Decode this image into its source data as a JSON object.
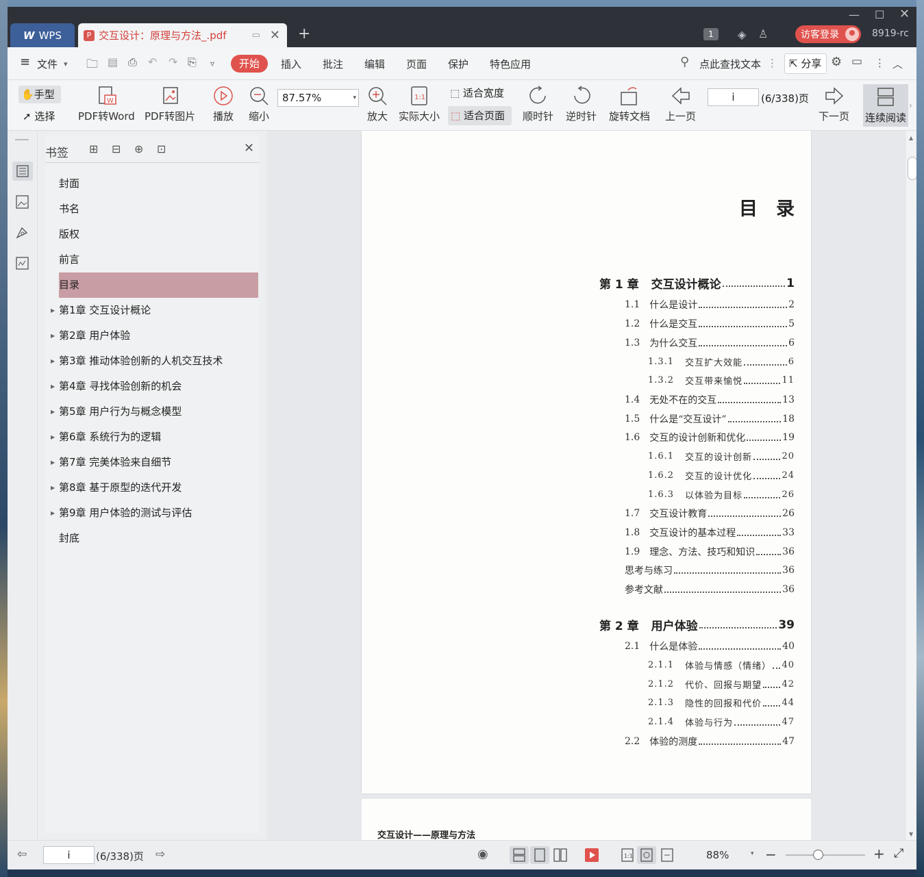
{
  "app": {
    "wps_tab": "WPS",
    "doc_tab": "交互设计：原理与方法_.pdf",
    "badge": "1",
    "login": "访客登录",
    "user": "8919-rc"
  },
  "menu": {
    "file": "文件",
    "start": "开始",
    "insert": "插入",
    "comment": "批注",
    "edit": "编辑",
    "page": "页面",
    "protect": "保护",
    "special": "特色应用",
    "search": "点此查找文本",
    "share": "分享"
  },
  "ribbon": {
    "hand": "手型",
    "select": "选择",
    "pdf2word": "PDF转Word",
    "pdf2img": "PDF转图片",
    "play": "播放",
    "zoom_out": "缩小",
    "zoom_value": "87.57%",
    "zoom_in": "放大",
    "actual": "实际大小",
    "fit_width": "适合宽度",
    "fit_page": "适合页面",
    "clockwise": "顺时针",
    "counter": "逆时针",
    "rotate": "旋转文档",
    "prev": "上一页",
    "page_input": "i",
    "page_total": "(6/338)页",
    "next": "下一页",
    "continuous": "连续阅读"
  },
  "panel": {
    "title": "书签",
    "items": [
      {
        "label": "封面",
        "expand": false
      },
      {
        "label": "书名",
        "expand": false
      },
      {
        "label": "版权",
        "expand": false
      },
      {
        "label": "前言",
        "expand": false
      },
      {
        "label": "目录",
        "expand": false,
        "selected": true
      },
      {
        "label": "第1章 交互设计概论",
        "expand": true
      },
      {
        "label": "第2章 用户体验",
        "expand": true
      },
      {
        "label": "第3章 推动体验创新的人机交互技术",
        "expand": true
      },
      {
        "label": "第4章 寻找体验创新的机会",
        "expand": true
      },
      {
        "label": "第5章 用户行为与概念模型",
        "expand": true
      },
      {
        "label": "第6章 系统行为的逻辑",
        "expand": true
      },
      {
        "label": "第7章 完美体验来自细节",
        "expand": true
      },
      {
        "label": "第8章 基于原型的迭代开发",
        "expand": true
      },
      {
        "label": "第9章 用户体验的测试与评估",
        "expand": true
      },
      {
        "label": "封底",
        "expand": false
      }
    ]
  },
  "page": {
    "title": "目　录",
    "toc": [
      {
        "level": "ch",
        "num": "第 1 章",
        "text": "交互设计概论",
        "page": "1"
      },
      {
        "level": "sec",
        "num": "1.1",
        "text": "什么是设计",
        "page": "2"
      },
      {
        "level": "sec",
        "num": "1.2",
        "text": "什么是交互",
        "page": "5"
      },
      {
        "level": "sec",
        "num": "1.3",
        "text": "为什么交互",
        "page": "6"
      },
      {
        "level": "sub",
        "num": "1.3.1",
        "text": "交互扩大效能",
        "page": "6"
      },
      {
        "level": "sub",
        "num": "1.3.2",
        "text": "交互带来愉悦",
        "page": "11"
      },
      {
        "level": "sec",
        "num": "1.4",
        "text": "无处不在的交互",
        "page": "13"
      },
      {
        "level": "sec",
        "num": "1.5",
        "text": "什么是“交互设计”",
        "page": "18"
      },
      {
        "level": "sec",
        "num": "1.6",
        "text": "交互的设计创新和优化",
        "page": "19"
      },
      {
        "level": "sub",
        "num": "1.6.1",
        "text": "交互的设计创新",
        "page": "20"
      },
      {
        "level": "sub",
        "num": "1.6.2",
        "text": "交互的设计优化",
        "page": "24"
      },
      {
        "level": "sub",
        "num": "1.6.3",
        "text": "以体验为目标",
        "page": "26"
      },
      {
        "level": "sec",
        "num": "1.7",
        "text": "交互设计教育",
        "page": "26"
      },
      {
        "level": "sec",
        "num": "1.8",
        "text": "交互设计的基本过程",
        "page": "33"
      },
      {
        "level": "sec",
        "num": "1.9",
        "text": "理念、方法、技巧和知识",
        "page": "36"
      },
      {
        "level": "extra",
        "num": "",
        "text": "思考与练习",
        "page": "36"
      },
      {
        "level": "extra",
        "num": "",
        "text": "参考文献",
        "page": "36"
      },
      {
        "level": "ch",
        "num": "第 2 章",
        "text": "用户体验",
        "page": "39"
      },
      {
        "level": "sec",
        "num": "2.1",
        "text": "什么是体验",
        "page": "40"
      },
      {
        "level": "sub",
        "num": "2.1.1",
        "text": "体验与情感（情绪）",
        "page": "40"
      },
      {
        "level": "sub",
        "num": "2.1.2",
        "text": "代价、回报与期望",
        "page": "42"
      },
      {
        "level": "sub",
        "num": "2.1.3",
        "text": "隐性的回报和代价",
        "page": "44"
      },
      {
        "level": "sub",
        "num": "2.1.4",
        "text": "体验与行为",
        "page": "47"
      },
      {
        "level": "sec",
        "num": "2.2",
        "text": "体验的测度",
        "page": "47"
      }
    ],
    "next_header": "交互设计——原理与方法"
  },
  "status": {
    "page_input": "i",
    "page_total": "(6/338)页",
    "zoom": "88%"
  }
}
